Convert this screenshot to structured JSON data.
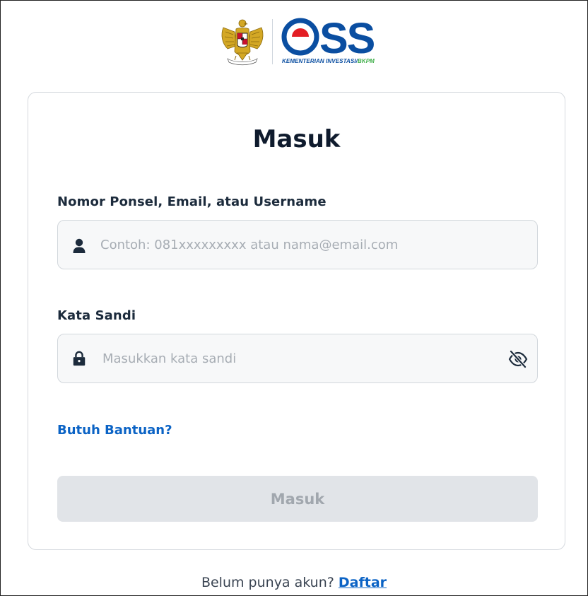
{
  "brand": {
    "logo_text": "OSS",
    "tagline_main": "KEMENTERIAN INVESTASI/",
    "tagline_accent": "BKPM",
    "colors": {
      "blue": "#0a4ea1",
      "red": "#e31e24",
      "green": "#3fae49",
      "gold": "#c9a227"
    }
  },
  "login": {
    "title": "Masuk",
    "username": {
      "label": "Nomor Ponsel, Email, atau Username",
      "value": "",
      "placeholder": "Contoh: 081xxxxxxxxx atau nama@email.com",
      "icon": "user-icon"
    },
    "password": {
      "label": "Kata Sandi",
      "value": "",
      "placeholder": "Masukkan kata sandi",
      "icon": "lock-icon",
      "toggle_icon": "eye-slash-icon"
    },
    "help_link": "Butuh Bantuan?",
    "submit_label": "Masuk"
  },
  "footer": {
    "prompt": "Belum punya akun?",
    "register_link": "Daftar"
  },
  "colors": {
    "link": "#0b63c5",
    "title": "#0f1b2d",
    "button_disabled_bg": "#e1e4e8",
    "button_disabled_text": "#a1a7ae"
  }
}
